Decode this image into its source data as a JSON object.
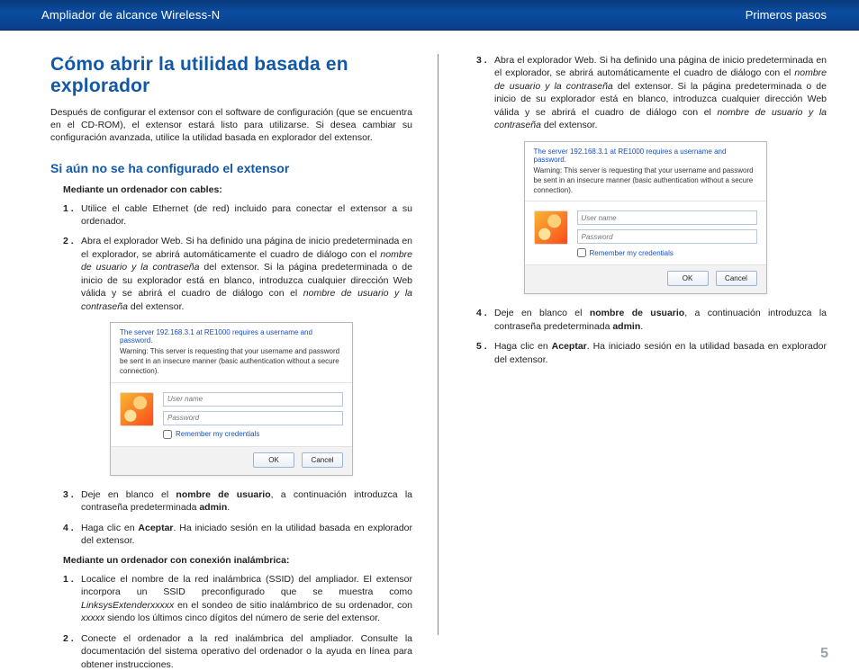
{
  "header": {
    "left": "Ampliador de alcance Wireless-N",
    "right": "Primeros pasos"
  },
  "title": "Cómo abrir la utilidad basada en explorador",
  "intro": "Después de configurar el extensor con el software de configuración (que se encuentra en el CD-ROM), el extensor estará listo para utilizarse. Si desea cambiar su configuración avanzada, utilice la utilidad basada en explorador del extensor.",
  "sub1": "Si aún no se ha configurado el extensor",
  "h_wired": "Mediante un ordenador con cables:",
  "wired": [
    {
      "n": "1 .",
      "t": "Utilice el cable Ethernet (de red) incluido para conectar el extensor a su ordenador."
    },
    {
      "n": "2 .",
      "t": "Abra el explorador Web. Si ha definido una página de inicio predeterminada en el explorador, se abrirá automáticamente el cuadro de diálogo con el ",
      "i1": "nombre de usuario y la contraseña",
      "t2": " del extensor. Si la página predeterminada o de inicio de su explorador está en blanco, introduzca cualquier dirección Web válida y se abrirá el cuadro de diálogo con el ",
      "i2": "nombre de usuario y la contraseña",
      "t3": " del extensor."
    },
    {
      "n": "3 .",
      "t": "Deje en blanco el ",
      "b1": "nombre de usuario",
      "t2": ", a continuación introduzca la contraseña predeterminada ",
      "b2": "admin",
      "t3": "."
    },
    {
      "n": "4 .",
      "t": "Haga clic en ",
      "b1": "Aceptar",
      "t2": ". Ha iniciado sesión en la utilidad basada en explorador del extensor."
    }
  ],
  "h_wireless": "Mediante un ordenador con conexión inalámbrica:",
  "wireless": [
    {
      "n": "1 .",
      "t": "Localice el nombre de la red inalámbrica (SSID) del ampliador. El extensor incorpora un SSID preconfigurado que se muestra como ",
      "i1": "LinksysExtenderxxxxx",
      "t2": " en el sondeo de sitio inalámbrico de su ordenador, con ",
      "i2": "xxxxx",
      "t3": " siendo los últimos cinco dígitos del número de serie del extensor."
    },
    {
      "n": "2 .",
      "t": "Conecte el ordenador a la red inalámbrica del ampliador. Consulte la documentación del sistema operativo del ordenador o la ayuda en línea para obtener instrucciones."
    }
  ],
  "right_steps": [
    {
      "n": "3 .",
      "t": "Abra el explorador Web. Si ha definido una página de inicio predeterminada en el explorador, se abrirá automáticamente el cuadro de diálogo con el ",
      "i1": "nombre de usuario y la contraseña",
      "t2": " del extensor. Si la página predeterminada o de inicio de su explorador está en blanco, introduzca cualquier dirección Web válida y se abrirá el cuadro de diálogo con el ",
      "i2": "nombre de usuario y la contraseña",
      "t3": " del extensor."
    },
    {
      "n": "4 .",
      "t": "Deje en blanco el ",
      "b1": "nombre de usuario",
      "t2": ", a continuación introduzca la contraseña predeterminada ",
      "b2": "admin",
      "t3": "."
    },
    {
      "n": "5 .",
      "t": "Haga clic en ",
      "b1": "Aceptar",
      "t2": ". Ha iniciado sesión en la utilidad basada en explorador del extensor."
    }
  ],
  "dialog": {
    "head": "The server 192.168.3.1 at RE1000 requires a username and password.",
    "warn": "Warning: This server is requesting that your username and password be sent in an insecure manner (basic authentication without a secure connection).",
    "user_ph": "User name",
    "pass_ph": "Password",
    "remember": "Remember my credentials",
    "ok": "OK",
    "cancel": "Cancel"
  },
  "page_number": "5"
}
